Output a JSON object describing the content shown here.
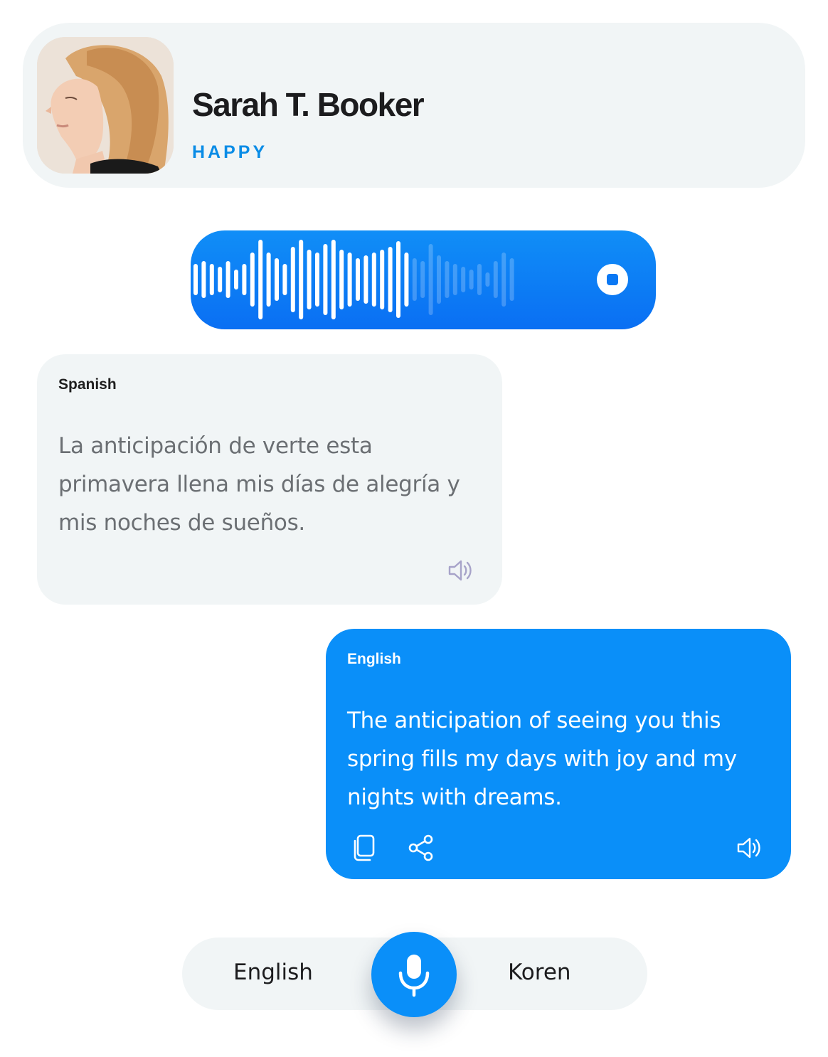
{
  "profile": {
    "name": "Sarah T. Booker",
    "mood": "HAPPY",
    "avatar_icon": "profile-photo"
  },
  "recorder": {
    "stop_icon": "stop-icon"
  },
  "source_message": {
    "language": "Spanish",
    "text": "La anticipación de verte esta primavera llena mis días de alegría y mis noches de sueños.",
    "speaker_icon": "speaker-icon"
  },
  "translated_message": {
    "language": "English",
    "text": "The anticipation of seeing you this spring fills my days with joy and my nights with dreams.",
    "copy_icon": "copy-icon",
    "share_icon": "share-icon",
    "speaker_icon": "speaker-icon"
  },
  "language_switcher": {
    "left_language": "English",
    "right_language": "Koren",
    "mic_icon": "microphone-icon"
  },
  "colors": {
    "accent": "#0a8ff9",
    "mood": "#0a8ce6",
    "card_bg": "#f1f5f6"
  }
}
